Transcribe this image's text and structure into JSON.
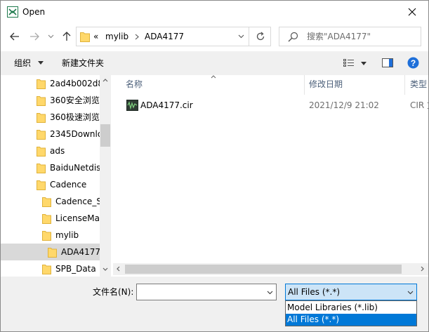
{
  "window": {
    "title": "Open"
  },
  "nav": {
    "overflow": "«",
    "path": [
      "mylib",
      "ADA4177"
    ],
    "search_placeholder": "搜索\"ADA4177\""
  },
  "toolbar": {
    "organize_label": "组织",
    "new_folder_label": "新建文件夹"
  },
  "tree": {
    "items": [
      {
        "label": "2ad4b002d8"
      },
      {
        "label": "360安全浏览"
      },
      {
        "label": "360极速浏览"
      },
      {
        "label": "2345Downlo"
      },
      {
        "label": "ads"
      },
      {
        "label": "BaiduNetdis"
      },
      {
        "label": "Cadence"
      },
      {
        "label": "Cadence_S"
      },
      {
        "label": "LicenseMa"
      },
      {
        "label": "mylib"
      },
      {
        "label": "ADA4177"
      },
      {
        "label": "SPB_Data"
      }
    ]
  },
  "list": {
    "columns": {
      "name": "名称",
      "date": "修改日期",
      "type": "类型"
    },
    "files": [
      {
        "name": "ADA4177.cir",
        "date": "2021/12/9 21:02",
        "type": "CIR 文"
      }
    ]
  },
  "bottom": {
    "filename_label": "文件名(N):",
    "filename_value": "",
    "filter_selected": "All Files (*.*)",
    "filter_options": [
      "Model Libraries (*.lib)",
      "All Files (*.*)"
    ]
  },
  "colors": {
    "accent": "#0078d7",
    "selection": "#cce4f7",
    "folder": "#ffd86b",
    "help": "#1e6fd9"
  }
}
